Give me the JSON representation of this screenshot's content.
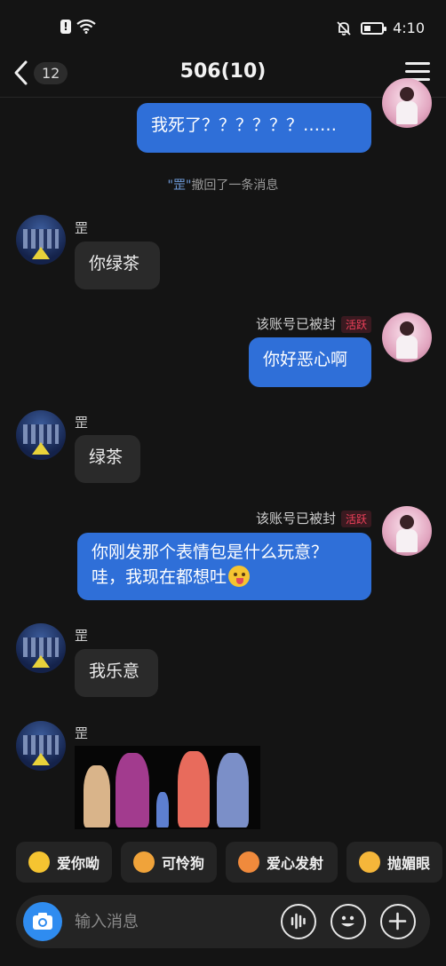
{
  "status": {
    "time": "4:10"
  },
  "nav": {
    "back_count": "12",
    "title": "506(10)"
  },
  "recall": {
    "name": "\"罡\"",
    "text": "撤回了一条消息"
  },
  "messages": [
    {
      "text": "我死了？？？？？？……"
    },
    {
      "sender": "罡",
      "text": "你绿茶"
    },
    {
      "sender": "该账号已被封",
      "tag": "活跃",
      "text": "你好恶心啊"
    },
    {
      "sender": "罡",
      "text": "绿茶"
    },
    {
      "sender": "该账号已被封",
      "tag": "活跃",
      "line1": "你刚发那个表情包是什么玩意？",
      "line2": "哇，我现在都想吐"
    },
    {
      "sender": "罡",
      "text": "我乐意"
    },
    {
      "sender": "罡"
    }
  ],
  "quick_replies": [
    {
      "label": "爱你呦",
      "icon": "heart-eyes-icon"
    },
    {
      "label": "可怜狗",
      "icon": "dog-face-icon"
    },
    {
      "label": "爱心发射",
      "icon": "heart-shooting-icon"
    },
    {
      "label": "抛媚眼",
      "icon": "wink-cat-icon"
    }
  ],
  "input": {
    "placeholder": "输入消息"
  },
  "colors": {
    "accent": "#2f6fd8",
    "camera": "#2f8cf0",
    "tag_red": "#f0405a"
  }
}
